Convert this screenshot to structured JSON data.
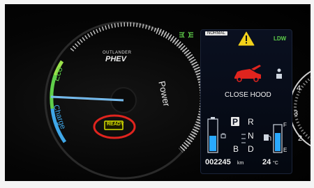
{
  "gauge": {
    "brand_line1": "OUTLANDER",
    "brand_line2": "PHEV",
    "label_eco": "Eco",
    "label_charge": "Charge",
    "label_power": "Power",
    "ready_text": "READY"
  },
  "top_bar": {
    "mode_badge": "NORMAL",
    "ldw_text": "LDW"
  },
  "display": {
    "message": "CLOSE HOOD",
    "gear_selected": "P",
    "gear_r": "R",
    "gear_n": "N",
    "gear_d": "D",
    "gear_b": "B",
    "fuel_full": "F",
    "fuel_empty": "E",
    "odometer": "002245",
    "odometer_unit": "km",
    "temperature": "24",
    "temperature_unit": "°C"
  },
  "colors": {
    "accent_red": "#e0241e",
    "warning_yellow": "#f3d21a",
    "ready_yellow": "#d7e000",
    "eco_green": "#5fcf4a",
    "charge_blue": "#3fa7e8",
    "lcd_blue": "#2aa9ff"
  },
  "icons": [
    "headlight-indicator-icon",
    "warning-triangle-icon",
    "car-hood-open-icon",
    "seatbelt-person-icon",
    "battery-icon",
    "fuel-pump-icon",
    "tachometer-partial-icon"
  ]
}
